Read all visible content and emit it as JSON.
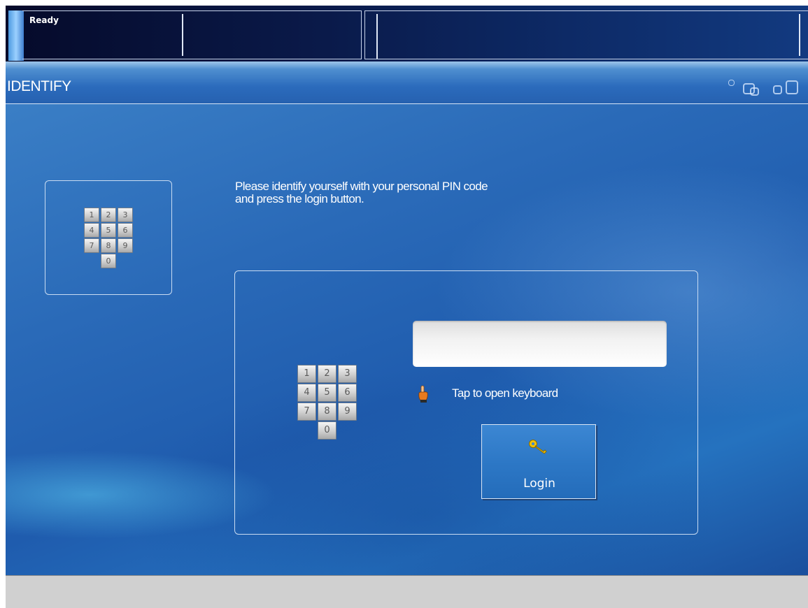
{
  "status": {
    "text": "Ready"
  },
  "header": {
    "title": "IDENTIFY"
  },
  "instructions": {
    "line1": "Please identify yourself with your personal PIN code",
    "line2": "and press the login button."
  },
  "keypad": {
    "keys": [
      "1",
      "2",
      "3",
      "4",
      "5",
      "6",
      "7",
      "8",
      "9",
      "0"
    ]
  },
  "pin": {
    "value": "",
    "placeholder": ""
  },
  "tap_hint": "Tap to open keyboard",
  "login": {
    "label": "Login"
  },
  "colors": {
    "background": "#2566b6",
    "header": "#2b6bbc",
    "key_icon": "#f2c200",
    "hand_icon": "#e07020"
  },
  "icons": [
    "numeric-keypad-icon",
    "hand-pointer-icon",
    "key-icon",
    "window-mode-icons"
  ]
}
